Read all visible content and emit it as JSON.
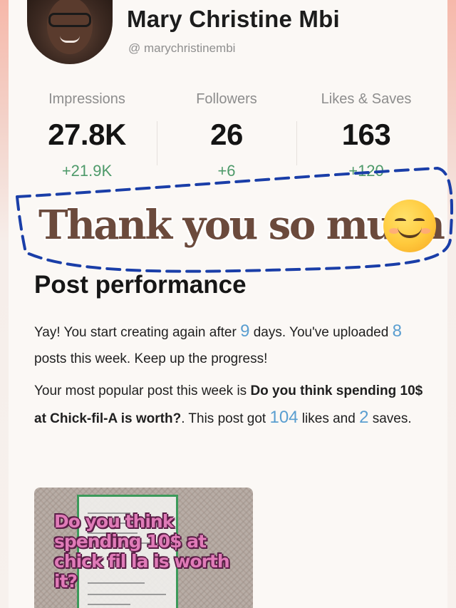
{
  "profile": {
    "name": "Mary Christine Mbi",
    "handle": "@ marychristinembi"
  },
  "stats": [
    {
      "label": "Impressions",
      "value": "27.8K",
      "delta": "+21.9K"
    },
    {
      "label": "Followers",
      "value": "26",
      "delta": "+6"
    },
    {
      "label": "Likes & Saves",
      "value": "163",
      "delta": "+120"
    }
  ],
  "overlay": {
    "text": "Thank you so much",
    "emoji": "smiling-face-with-smiling-eyes"
  },
  "performance": {
    "title": "Post performance",
    "p1_a": "Yay! You start creating again after ",
    "p1_days": "9",
    "p1_b": " days. You've uploaded ",
    "p1_posts": "8",
    "p1_c": " posts this week. Keep up the progress!",
    "p2_a": "Your most popular post this week is ",
    "p2_post": "Do you think spending 10$ at Chick-fil-A is worth?",
    "p2_b": ". This post got ",
    "p2_likes": "104",
    "p2_c": " likes and ",
    "p2_saves": "2",
    "p2_d": " saves."
  },
  "thumbnail": {
    "text": "Do you think spending 10$ at chick fil la is worth it?"
  },
  "colors": {
    "accent_number": "#5a9ed0",
    "delta_green": "#4e9a6a",
    "dash_blue": "#1a3ea8"
  }
}
